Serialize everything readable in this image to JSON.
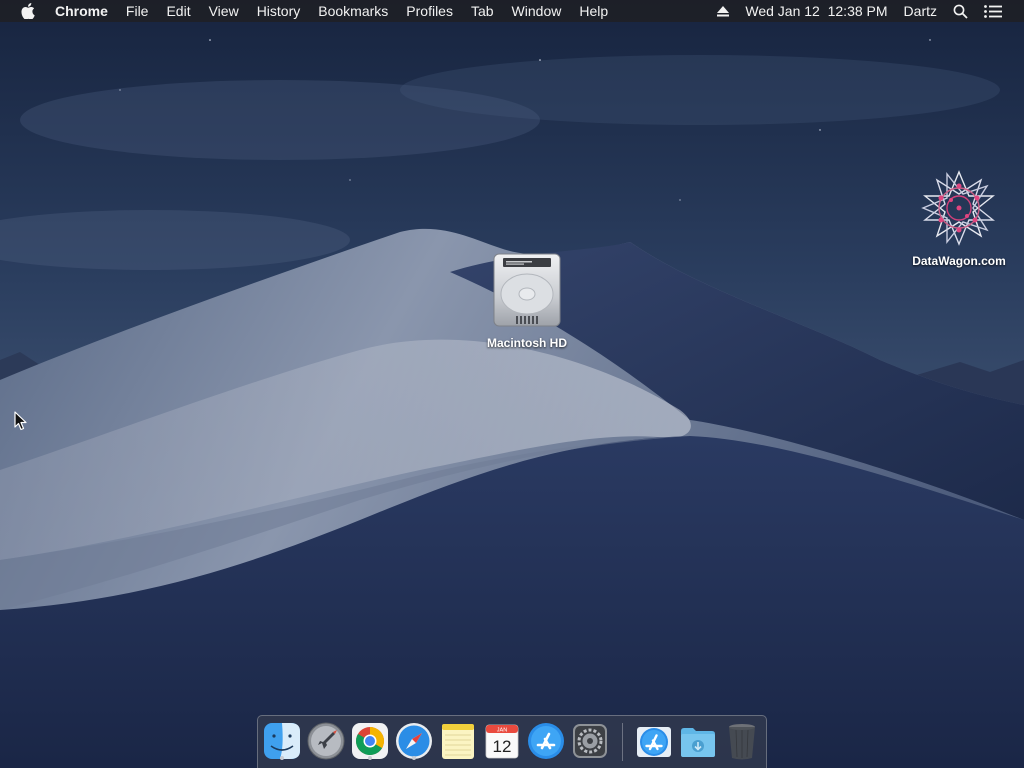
{
  "menubar": {
    "app_name": "Chrome",
    "items": [
      "File",
      "Edit",
      "View",
      "History",
      "Bookmarks",
      "Profiles",
      "Tab",
      "Window",
      "Help"
    ],
    "datetime": "Wed Jan 12  12:38 PM",
    "user": "Dartz"
  },
  "desktop": {
    "icons": [
      {
        "label": "Macintosh HD",
        "icon": "hard-drive-icon"
      },
      {
        "label": "DataWagon.com",
        "icon": "datawagon-logo-icon"
      }
    ]
  },
  "dock": {
    "apps": [
      {
        "name": "Finder",
        "icon": "finder-icon",
        "running": true
      },
      {
        "name": "Launchpad",
        "icon": "launchpad-icon",
        "running": false
      },
      {
        "name": "Google Chrome",
        "icon": "chrome-icon",
        "running": true
      },
      {
        "name": "Safari",
        "icon": "safari-icon",
        "running": true
      },
      {
        "name": "Notes",
        "icon": "notes-icon",
        "running": false
      },
      {
        "name": "Calendar",
        "icon": "calendar-icon",
        "running": false,
        "month": "JAN",
        "day": "12"
      },
      {
        "name": "App Store",
        "icon": "app-store-icon",
        "running": false
      },
      {
        "name": "System Preferences",
        "icon": "system-preferences-icon",
        "running": false
      },
      {
        "name": "Applications",
        "icon": "applications-folder-icon",
        "running": false
      },
      {
        "name": "Downloads",
        "icon": "downloads-folder-icon",
        "running": false
      },
      {
        "name": "Trash",
        "icon": "trash-icon",
        "running": false
      }
    ]
  },
  "colors": {
    "menubar_bg": "#1e2026",
    "sky_top": "#1b2a48",
    "sky_mid": "#3c5170",
    "dune_light": "#8e98ad",
    "dune_dark": "#1f2c4d"
  }
}
